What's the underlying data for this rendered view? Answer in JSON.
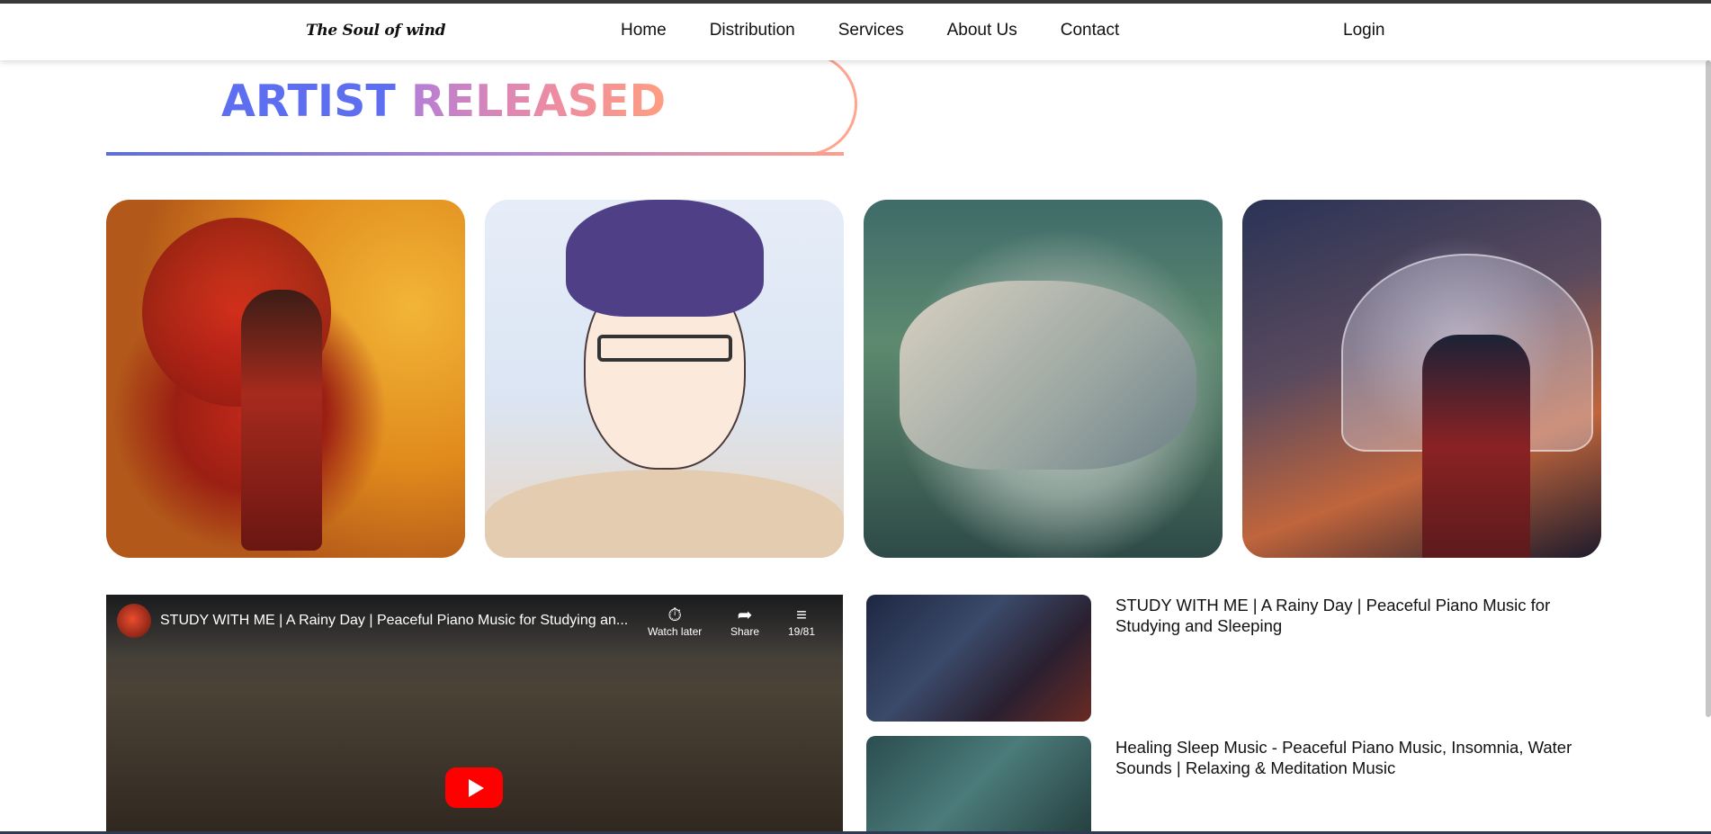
{
  "nav": {
    "logo": "The Soul of wind",
    "links": [
      "Home",
      "Distribution",
      "Services",
      "About Us",
      "Contact"
    ],
    "login": "Login"
  },
  "section": {
    "heading_part1": "ARTIST",
    "heading_part2": "RELEASED"
  },
  "artists": [
    {
      "image": "red-kimono-umbrella-girl"
    },
    {
      "image": "smiling-glasses-boy"
    },
    {
      "image": "sleeping-forest-girl"
    },
    {
      "image": "rainy-city-umbrella"
    }
  ],
  "video": {
    "title": "STUDY WITH ME | A Rainy Day | Peaceful Piano Music for Studying an...",
    "watch_later": "Watch later",
    "share": "Share",
    "playlist_count": "19/81"
  },
  "playlist": [
    {
      "title": "STUDY WITH ME | A Rainy Day | Peaceful Piano Music for Studying and Sleeping"
    },
    {
      "title": "Healing Sleep Music - Peaceful Piano Music, Insomnia, Water Sounds | Relaxing & Meditation Music"
    }
  ],
  "colors": {
    "heading_blue": "#5d6ff0",
    "heading_pink": "#e98aa8",
    "heading_orange": "#ff9e80",
    "youtube_red": "#ff0000"
  }
}
